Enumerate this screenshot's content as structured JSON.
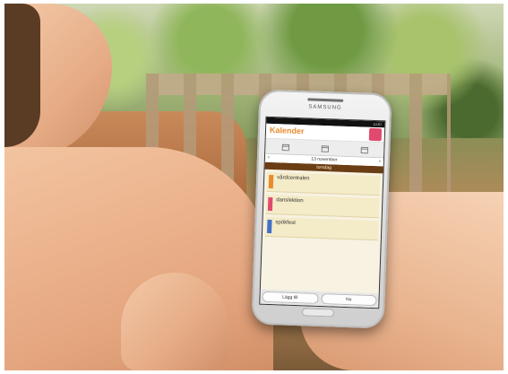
{
  "phone": {
    "brand": "SAMSUNG",
    "status_time": "14:57"
  },
  "app": {
    "title": "Kalender",
    "date_label": "13 november",
    "day_label": "torsdag",
    "prev_icon": "chevron-left-icon",
    "next_icon": "chevron-right-icon",
    "tab_icons": [
      "calendar-icon",
      "calendar-icon",
      "calendar-icon"
    ]
  },
  "events": [
    {
      "name": "vårdcentralen",
      "color": "#e98a2c"
    },
    {
      "name": "danslektion",
      "color": "#e04a6f"
    },
    {
      "name": "spökfest",
      "color": "#3f6fc9"
    }
  ],
  "buttons": {
    "add_label": "Lägg till",
    "now_label": "Nu"
  }
}
